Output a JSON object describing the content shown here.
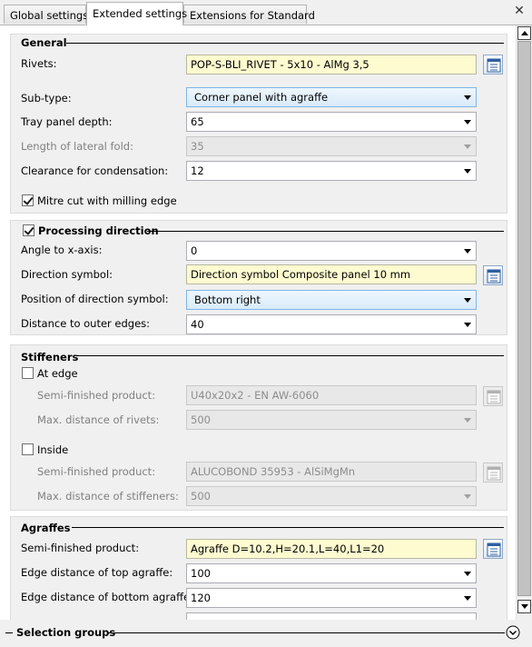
{
  "tabs": [
    {
      "label": "Global settings"
    },
    {
      "label": "Extended settings"
    },
    {
      "label": "Extensions for Standard"
    }
  ],
  "close_label": "✕",
  "general": {
    "title": "General",
    "rivets_label": "Rivets:",
    "rivets_value": "POP-S-BLI_RIVET -  5x10 - AlMg 3,5",
    "subtype_label": "Sub-type:",
    "subtype_value": "Corner panel with agraffe",
    "tray_depth_label": "Tray panel depth:",
    "tray_depth_value": "65",
    "lateral_fold_label": "Length of lateral fold:",
    "lateral_fold_value": "35",
    "clearance_label": "Clearance for condensation:",
    "clearance_value": "12",
    "mitre_label": "Mitre cut with milling edge",
    "mitre_checked": true
  },
  "processing": {
    "title": "Processing direction",
    "checked": true,
    "angle_label": "Angle to x-axis:",
    "angle_value": "0",
    "symbol_label": "Direction symbol:",
    "symbol_value": "Direction symbol Composite panel 10 mm",
    "position_label": "Position of direction symbol:",
    "position_value": "Bottom right",
    "distance_label": "Distance to outer edges:",
    "distance_value": "40"
  },
  "stiffeners": {
    "title": "Stiffeners",
    "at_edge_label": "At edge",
    "at_edge_checked": false,
    "edge_product_label": "Semi-finished product:",
    "edge_product_value": "U40x20x2 - EN AW-6060",
    "edge_maxdist_label": "Max. distance of rivets:",
    "edge_maxdist_value": "500",
    "inside_label": "Inside",
    "inside_checked": false,
    "inside_product_label": "Semi-finished product:",
    "inside_product_value": "ALUCOBOND 35953 - AlSiMgMn",
    "inside_maxdist_label": "Max. distance of stiffeners:",
    "inside_maxdist_value": "500"
  },
  "agraffes": {
    "title": "Agraffes",
    "product_label": "Semi-finished product:",
    "product_value": "Agraffe D=10.2,H=20.1,L=40,L1=20",
    "top_label": "Edge distance of top agraffe:",
    "top_value": "100",
    "bottom_label": "Edge distance of bottom agraffe:",
    "bottom_value": "120"
  },
  "selection_groups": {
    "title": "Selection groups"
  },
  "icons": [
    "close-icon",
    "chevron-down-icon",
    "catalog-icon",
    "checkbox-icon",
    "collapse-icon",
    "scroll-up-icon",
    "scroll-down-icon"
  ]
}
